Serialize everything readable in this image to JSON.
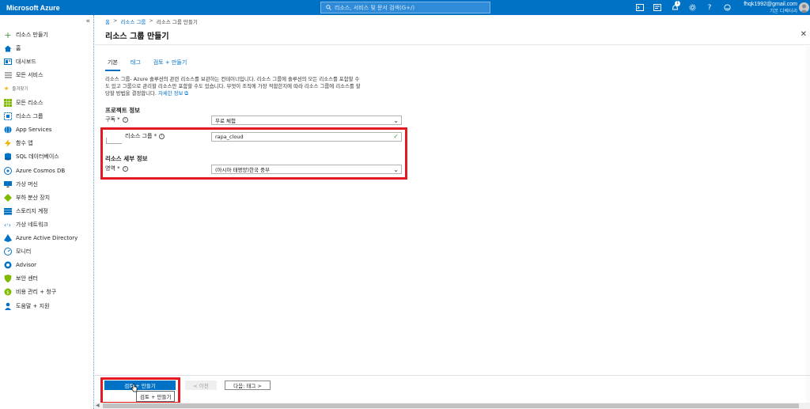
{
  "topbar": {
    "brand": "Microsoft Azure",
    "search_placeholder": "리소스, 서비스 및 문서 검색(G+/)",
    "notification_count": "1",
    "account_email": "fhqk1992@gmail.com",
    "account_directory": "기본 디렉터리"
  },
  "sidebar": {
    "collapse": "«",
    "create": "리소스 만들기",
    "home": "홈",
    "dashboard": "대시보드",
    "all_services": "모든 서비스",
    "favorites": "즐겨찾기",
    "items": [
      {
        "label": "모든 리소스",
        "icon": "grid-icon"
      },
      {
        "label": "리소스 그룹",
        "icon": "resource-group-icon"
      },
      {
        "label": "App Services",
        "icon": "globe-icon"
      },
      {
        "label": "함수 앱",
        "icon": "lightning-icon"
      },
      {
        "label": "SQL 데이터베이스",
        "icon": "sql-icon"
      },
      {
        "label": "Azure Cosmos DB",
        "icon": "cosmos-icon"
      },
      {
        "label": "가상 머신",
        "icon": "monitor-icon"
      },
      {
        "label": "부하 분산 장치",
        "icon": "diamond-icon"
      },
      {
        "label": "스토리지 계정",
        "icon": "storage-icon"
      },
      {
        "label": "가상 네트워크",
        "icon": "network-icon"
      },
      {
        "label": "Azure Active Directory",
        "icon": "aad-icon"
      },
      {
        "label": "모니터",
        "icon": "gauge-icon"
      },
      {
        "label": "Advisor",
        "icon": "advisor-icon"
      },
      {
        "label": "보안 센터",
        "icon": "shield-icon"
      },
      {
        "label": "비용 관리 + 청구",
        "icon": "cost-icon"
      },
      {
        "label": "도움말 + 지원",
        "icon": "person-icon"
      }
    ]
  },
  "breadcrumb": {
    "home": "홈",
    "rg": "리소스 그룹",
    "current": "리소스 그룹 만들기"
  },
  "page": {
    "title": "리소스 그룹 만들기",
    "tabs": [
      "기본",
      "태그",
      "검토 + 만들기"
    ],
    "description_line1": "리소스 그룹- Azure 솔루션의 관련 리소스를 보관하는 컨테이너입니다. 리소스 그룹에 솔루션의 모든 리소스를 포함할 수",
    "description_line2": "도 있고 그룹으로 관리할 리소스만 포함할 수도 있습니다. 무엇이 조직에 가장 적합한지에 따라 리소스 그룹에 리소스를 할",
    "description_line3": "당할 방법을 결정합니다.",
    "learn_more": "자세한 정보",
    "project_heading": "프로젝트 정보",
    "subscription_label": "구독 *",
    "subscription_value": "무료 체험",
    "rg_label": "리소스 그룹 *",
    "rg_value": "rapa_cloud",
    "resource_heading": "리소스 세부 정보",
    "region_label": "영역 *",
    "region_value": "(아시아 태평양)한국 중부"
  },
  "footer": {
    "review_create": "검토 + 만들기",
    "previous": "< 이전",
    "next": "다음: 태그 >",
    "tooltip": "검토 + 만들기"
  }
}
